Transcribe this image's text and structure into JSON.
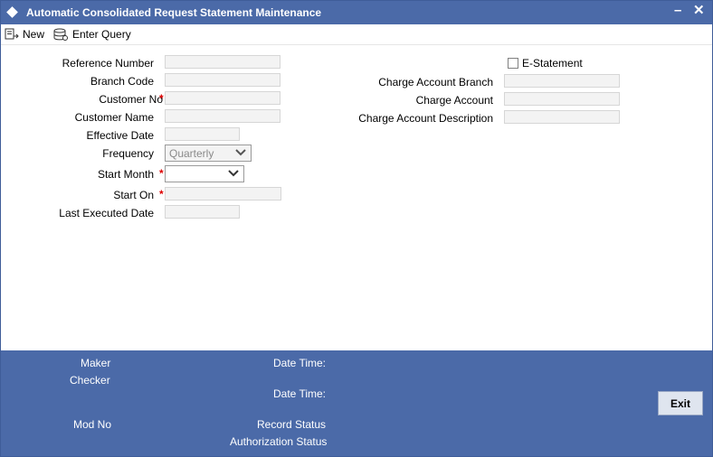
{
  "window": {
    "title": "Automatic Consolidated Request Statement Maintenance",
    "minimize_label": "–",
    "close_label": "✕"
  },
  "toolbar": {
    "new_label": "New",
    "enter_query_label": "Enter Query"
  },
  "form": {
    "reference_number": {
      "label": "Reference Number",
      "value": ""
    },
    "branch_code": {
      "label": "Branch Code",
      "value": ""
    },
    "customer_no": {
      "label": "Customer No",
      "value": "",
      "required": "*"
    },
    "customer_name": {
      "label": "Customer Name",
      "value": ""
    },
    "effective_date": {
      "label": "Effective Date",
      "value": ""
    },
    "frequency": {
      "label": "Frequency",
      "value": "Quarterly"
    },
    "start_month": {
      "label": "Start Month",
      "value": "",
      "required": "*"
    },
    "start_on": {
      "label": "Start On",
      "value": "",
      "required": "*"
    },
    "last_executed_date": {
      "label": "Last Executed Date",
      "value": ""
    },
    "e_statement": {
      "label": "E-Statement",
      "checked": false
    },
    "charge_account_branch": {
      "label": "Charge Account Branch",
      "value": ""
    },
    "charge_account": {
      "label": "Charge Account",
      "value": ""
    },
    "charge_account_description": {
      "label": "Charge Account Description",
      "value": ""
    }
  },
  "footer": {
    "maker_label": "Maker",
    "checker_label": "Checker",
    "date_time_label_1": "Date Time:",
    "date_time_label_2": "Date Time:",
    "mod_no_label": "Mod No",
    "record_status_label": "Record Status",
    "authorization_status_label": "Authorization Status",
    "exit_label": "Exit"
  },
  "colors": {
    "title_bar": "#4b6aa8",
    "footer": "#4b6aa8",
    "required_marker": "#dd0000"
  }
}
